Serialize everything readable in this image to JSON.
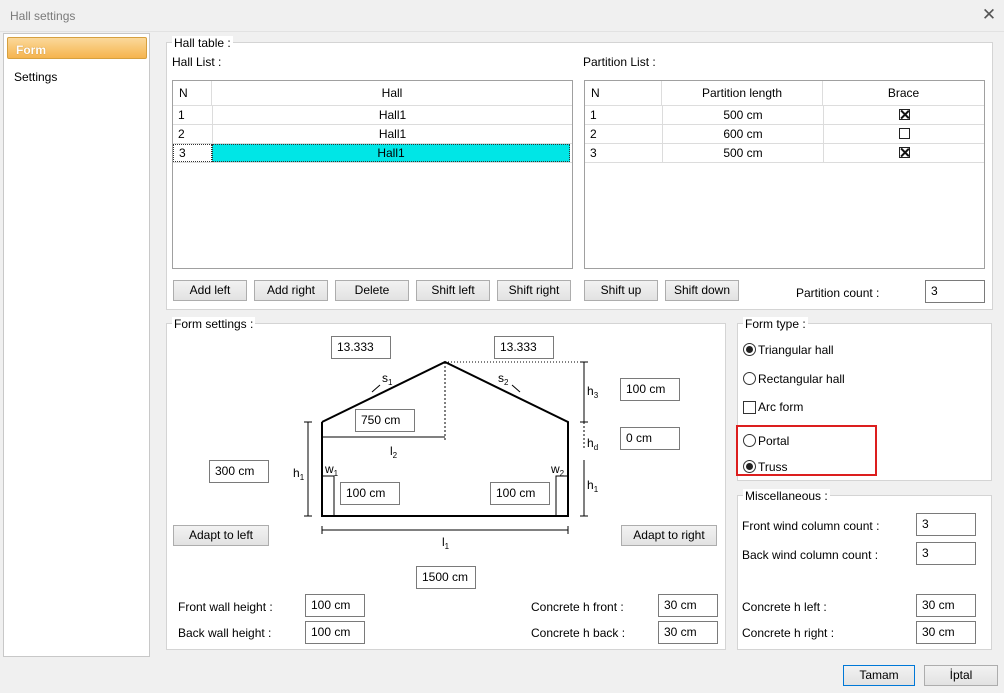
{
  "window": {
    "title": "Hall settings"
  },
  "sidebar": {
    "items": [
      {
        "label": "Form"
      },
      {
        "label": "Settings"
      }
    ]
  },
  "hall_table": {
    "label": "Hall table :",
    "hall_list": {
      "label": "Hall List :",
      "headers": [
        "N",
        "Hall"
      ],
      "rows": [
        {
          "n": "1",
          "hall": "Hall1"
        },
        {
          "n": "2",
          "hall": "Hall1"
        },
        {
          "n": "3",
          "hall": "Hall1"
        }
      ],
      "selected_row": 3
    },
    "partition_list": {
      "label": "Partition List :",
      "headers": [
        "N",
        "Partition length",
        "Brace"
      ],
      "rows": [
        {
          "n": "1",
          "length": "500 cm",
          "brace": true
        },
        {
          "n": "2",
          "length": "600 cm",
          "brace": false
        },
        {
          "n": "3",
          "length": "500 cm",
          "brace": true
        }
      ]
    },
    "buttons": {
      "add_left": "Add left",
      "add_right": "Add right",
      "delete": "Delete",
      "shift_left": "Shift left",
      "shift_right": "Shift right",
      "shift_up": "Shift up",
      "shift_down": "Shift down"
    },
    "partition_count": {
      "label": "Partition count :",
      "value": "3"
    }
  },
  "form_settings": {
    "label": "Form settings :",
    "s1_value": "13.333",
    "s2_value": "13.333",
    "l2_value": "750 cm",
    "h3_value": "100 cm",
    "hd_value": "0 cm",
    "h1_value": "300 cm",
    "w1_value": "100 cm",
    "w2_value": "100 cm",
    "l1_value": "1500 cm",
    "adapt_left": "Adapt to left",
    "adapt_right": "Adapt to right",
    "front_wall_height": {
      "label": "Front wall height :",
      "value": "100 cm"
    },
    "back_wall_height": {
      "label": "Back wall height :",
      "value": "100 cm"
    },
    "concrete_h_front": {
      "label": "Concrete h front :",
      "value": "30 cm"
    },
    "concrete_h_back": {
      "label": "Concrete h back :",
      "value": "30 cm"
    },
    "diagram_labels": {
      "s": "s",
      "l": "l",
      "h": "h",
      "w": "w",
      "sub1": "1",
      "sub2": "2",
      "sub3": "3",
      "subd": "d"
    }
  },
  "form_type": {
    "label": "Form type :",
    "triangular": {
      "label": "Triangular hall",
      "checked": true
    },
    "rectangular": {
      "label": "Rectangular hall",
      "checked": false
    },
    "arc": {
      "label": "Arc form",
      "checked": false
    },
    "portal": {
      "label": "Portal",
      "checked": false
    },
    "truss": {
      "label": "Truss",
      "checked": true
    },
    "highlight_color": "#dc1e1e"
  },
  "misc": {
    "label": "Miscellaneous :",
    "front_wind": {
      "label": "Front wind column count :",
      "value": "3"
    },
    "back_wind": {
      "label": "Back wind column count :",
      "value": "3"
    },
    "concrete_left": {
      "label": "Concrete h left :",
      "value": "30 cm"
    },
    "concrete_right": {
      "label": "Concrete h right :",
      "value": "30 cm"
    }
  },
  "footer": {
    "ok": "Tamam",
    "cancel": "İptal"
  },
  "colors": {
    "selected_row": "#00e6e6",
    "nav_active": "#f5b44e"
  }
}
